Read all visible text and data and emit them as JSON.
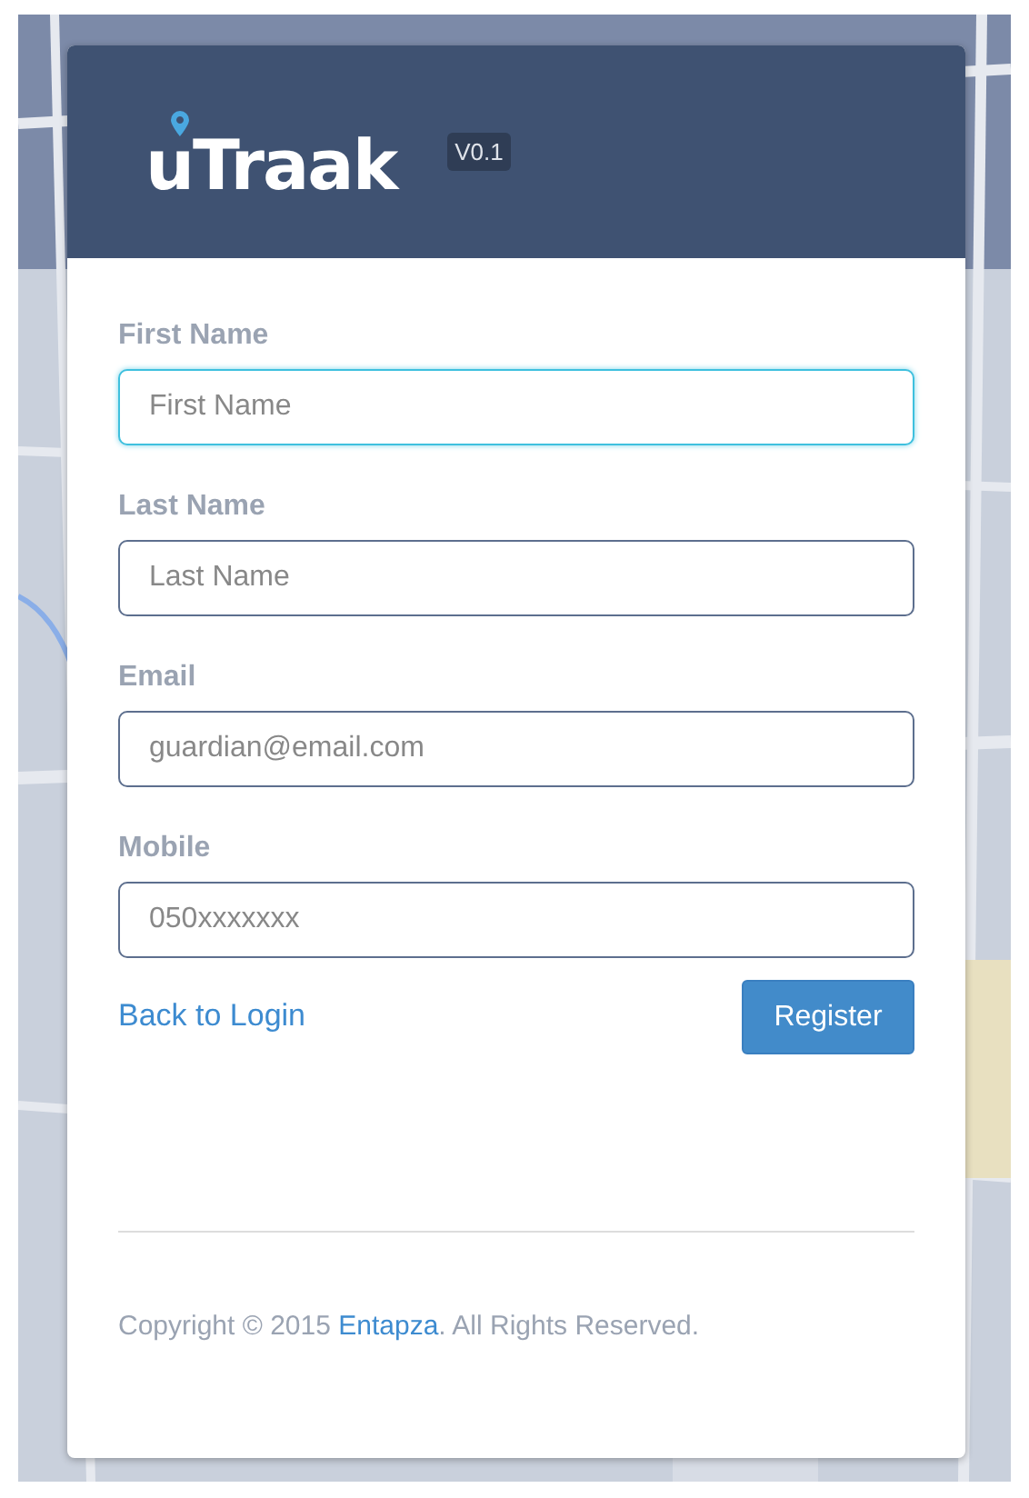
{
  "header": {
    "logo": "uTraak",
    "version": "V0.1"
  },
  "fields": [
    {
      "label": "First Name",
      "placeholder": "First Name",
      "focused": true
    },
    {
      "label": "Last Name",
      "placeholder": "Last Name",
      "focused": false
    },
    {
      "label": "Email",
      "placeholder": "guardian@email.com",
      "focused": false
    },
    {
      "label": "Mobile",
      "placeholder": "050xxxxxxx",
      "focused": false
    }
  ],
  "back_link": "Back to Login",
  "register_button": "Register",
  "footer": {
    "before": "Copyright © 2015 ",
    "link": "Entapza",
    "after": ". All Rights Reserved."
  }
}
